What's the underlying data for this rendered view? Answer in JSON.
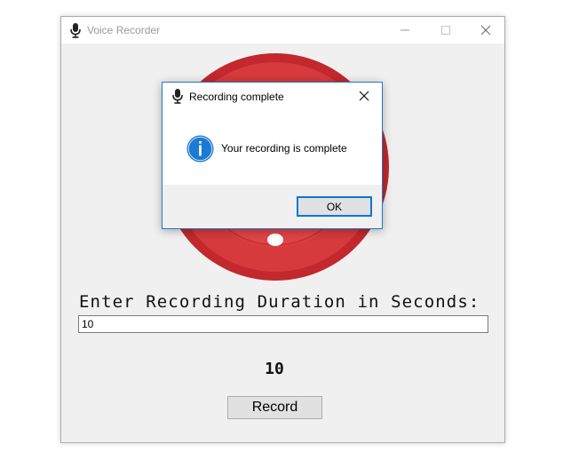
{
  "main_window": {
    "title": "Voice Recorder",
    "title_icon": "microphone-icon",
    "controls": [
      "minimize-icon",
      "maximize-icon",
      "close-icon"
    ]
  },
  "recorder": {
    "graphic": "record-button-graphic",
    "prompt": "Enter Recording Duration in Seconds:",
    "duration_value": "10",
    "countdown": "10",
    "record_label": "Record"
  },
  "dialog": {
    "title": "Recording complete",
    "title_icon": "microphone-icon",
    "icon": "info-icon",
    "message": "Your recording is complete",
    "ok_label": "OK",
    "accent": "#0078d7"
  },
  "colors": {
    "record_red": "#d63a3c",
    "record_red_dark": "#b9262b",
    "info_blue": "#1c7ad4",
    "window_bg": "#f0f0f0"
  }
}
